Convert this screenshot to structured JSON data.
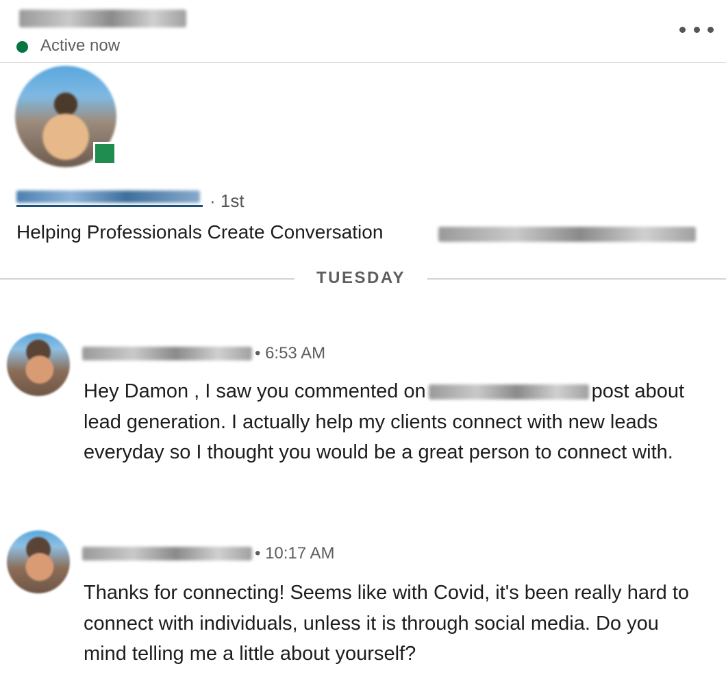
{
  "header": {
    "status": "Active now",
    "more_icon": "ellipsis-horizontal-icon"
  },
  "profile": {
    "degree": "· 1st",
    "headline": "Helping Professionals Create Conversation"
  },
  "day_divider": "TUESDAY",
  "messages": [
    {
      "time": "• 6:53 AM",
      "text_before": "Hey Damon , I saw you commented on",
      "text_after": "post about lead generation. I actually help my clients connect with new leads everyday so I thought you would be a great person to connect with."
    },
    {
      "time": "• 10:17 AM",
      "text": "Thanks for connecting! Seems like with Covid, it's been really hard to connect with individuals, unless it is through social media. Do you mind telling me a little about yourself?"
    }
  ],
  "colors": {
    "online": "#057642",
    "link_underline": "#1d4f73",
    "divider": "#d6d3cc",
    "muted_text": "#5e5e5e"
  }
}
